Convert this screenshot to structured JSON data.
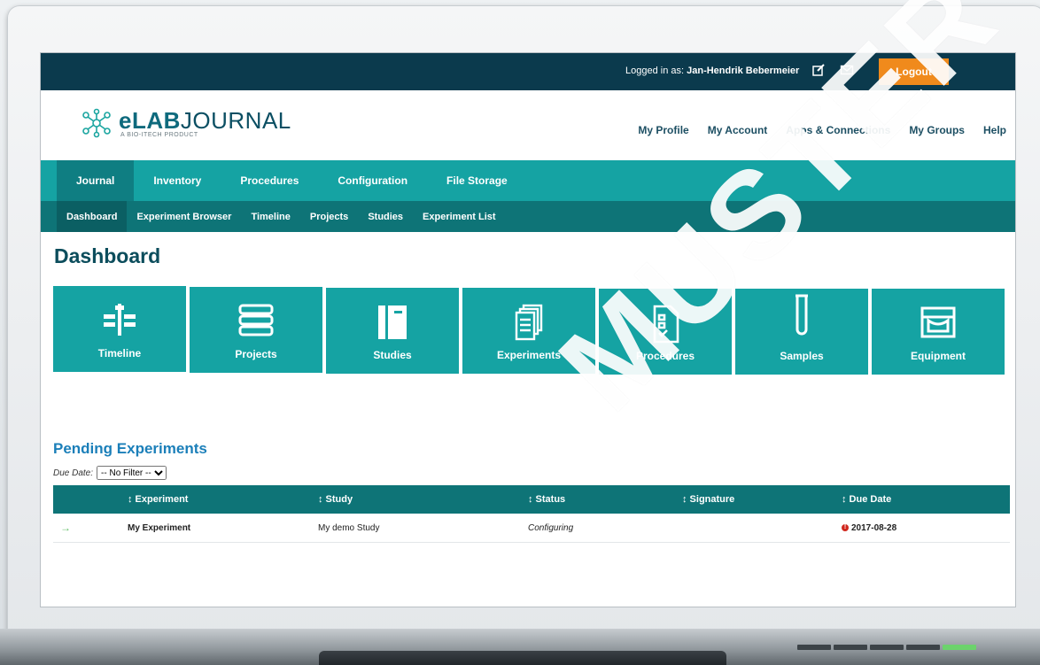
{
  "topbar": {
    "logged_in_label": "Logged in as:",
    "user_name": "Jan-Hendrik Bebermeier",
    "logout_label": "Logout"
  },
  "header": {
    "brand_prefix": "eLAB",
    "brand_suffix": "JOURNAL",
    "tagline": "A BIO-ITECH PRODUCT",
    "links": [
      "My Profile",
      "My Account",
      "Apps & Connections",
      "My Groups",
      "Help"
    ]
  },
  "main_nav": {
    "tabs": [
      "Journal",
      "Inventory",
      "Procedures",
      "Configuration",
      "File Storage"
    ],
    "active": "Journal"
  },
  "sub_nav": {
    "tabs": [
      "Dashboard",
      "Experiment Browser",
      "Timeline",
      "Projects",
      "Studies",
      "Experiment List"
    ],
    "active": "Dashboard"
  },
  "page": {
    "title": "Dashboard"
  },
  "tiles": [
    {
      "label": "Timeline",
      "icon": "timeline-icon"
    },
    {
      "label": "Projects",
      "icon": "books-icon"
    },
    {
      "label": "Studies",
      "icon": "notebook-icon"
    },
    {
      "label": "Experiments",
      "icon": "documents-icon"
    },
    {
      "label": "Procedures",
      "icon": "checklist-icon"
    },
    {
      "label": "Samples",
      "icon": "test-tube-icon"
    },
    {
      "label": "Equipment",
      "icon": "equipment-icon"
    }
  ],
  "pending": {
    "title": "Pending Experiments",
    "filter_label": "Due Date:",
    "filter_value": "-- No Filter --",
    "columns": [
      "↕ Experiment",
      "↕ Study",
      "↕ Status",
      "↕ Signature",
      "↕ Due Date"
    ],
    "rows": [
      {
        "experiment": "My Experiment",
        "study": "My demo Study",
        "status": "Configuring",
        "signature": "",
        "due_date": "2017-08-28"
      }
    ]
  },
  "watermark": "MUSTER SAMPLE",
  "colors": {
    "topbar": "#0b3a4d",
    "teal": "#15a3a3",
    "teal_dark": "#0e7477",
    "logout": "#f08a1c",
    "overdue": "#d0281e"
  }
}
